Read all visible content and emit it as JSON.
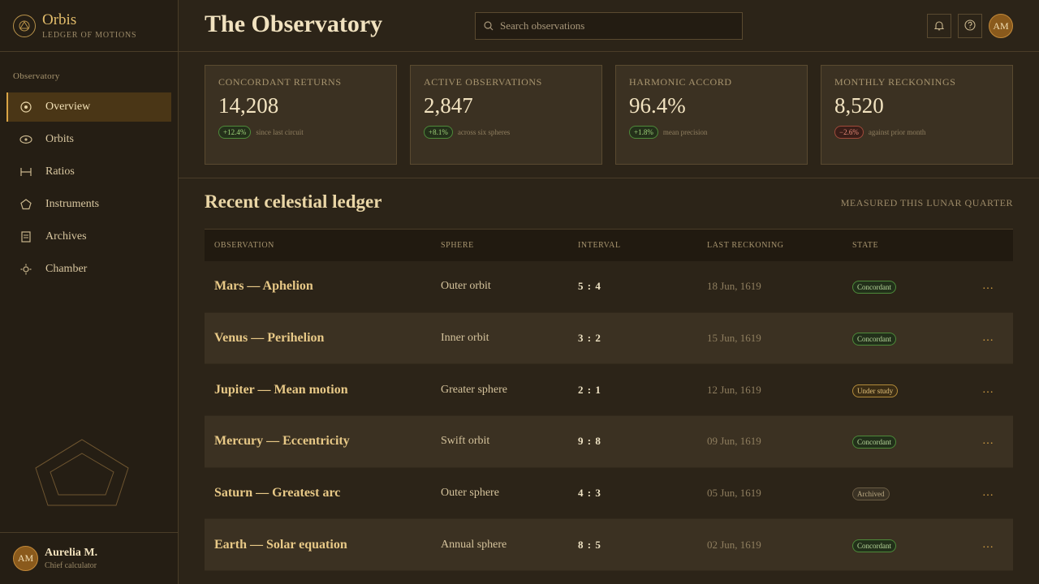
{
  "brand": {
    "name": "Orbis",
    "subtitle": "LEDGER OF MOTIONS"
  },
  "sidebar": {
    "section_label": "Observatory",
    "items": [
      {
        "label": "Overview",
        "icon": "target-icon",
        "active": true
      },
      {
        "label": "Orbits",
        "icon": "eye-orbit-icon",
        "active": false
      },
      {
        "label": "Ratios",
        "icon": "ratio-icon",
        "active": false
      },
      {
        "label": "Instruments",
        "icon": "pentagon-icon",
        "active": false
      },
      {
        "label": "Archives",
        "icon": "document-icon",
        "active": false
      },
      {
        "label": "Chamber",
        "icon": "sun-icon",
        "active": false
      }
    ]
  },
  "user": {
    "initials": "AM",
    "name": "Aurelia M.",
    "role": "Chief calculator"
  },
  "header": {
    "title": "The Observatory",
    "search_placeholder": "Search observations",
    "avatar_initials": "AM"
  },
  "stats": [
    {
      "label": "CONCORDANT RETURNS",
      "value": "14,208",
      "change": "+12.4%",
      "note": "since last circuit",
      "positive": true
    },
    {
      "label": "ACTIVE OBSERVATIONS",
      "value": "2,847",
      "change": "+8.1%",
      "note": "across six spheres",
      "positive": true
    },
    {
      "label": "HARMONIC ACCORD",
      "value": "96.4%",
      "change": "+1.8%",
      "note": "mean precision",
      "positive": true
    },
    {
      "label": "MONTHLY RECKONINGS",
      "value": "8,520",
      "change": "−2.6%",
      "note": "against prior month",
      "positive": false
    }
  ],
  "ledger": {
    "title": "Recent celestial ledger",
    "caption": "MEASURED THIS LUNAR QUARTER",
    "columns": [
      "OBSERVATION",
      "SPHERE",
      "INTERVAL",
      "LAST RECKONING",
      "STATE"
    ],
    "more_glyph": "…",
    "rows": [
      {
        "observation": "Mars — Aphelion",
        "sphere": "Outer orbit",
        "interval": "5 : 4",
        "date": "18 Jun, 1619",
        "state": "Concordant"
      },
      {
        "observation": "Venus — Perihelion",
        "sphere": "Inner orbit",
        "interval": "3 : 2",
        "date": "15 Jun, 1619",
        "state": "Concordant"
      },
      {
        "observation": "Jupiter — Mean motion",
        "sphere": "Greater sphere",
        "interval": "2 : 1",
        "date": "12 Jun, 1619",
        "state": "Under study"
      },
      {
        "observation": "Mercury — Eccentricity",
        "sphere": "Swift orbit",
        "interval": "9 : 8",
        "date": "09 Jun, 1619",
        "state": "Concordant"
      },
      {
        "observation": "Saturn — Greatest arc",
        "sphere": "Outer sphere",
        "interval": "4 : 3",
        "date": "05 Jun, 1619",
        "state": "Archived"
      },
      {
        "observation": "Earth — Solar equation",
        "sphere": "Annual sphere",
        "interval": "8 : 5",
        "date": "02 Jun, 1619",
        "state": "Concordant"
      }
    ]
  },
  "colors": {
    "accent": "#d9a445",
    "background": "#2c2418",
    "positive": "#9fd27a",
    "negative": "#e88a78"
  }
}
